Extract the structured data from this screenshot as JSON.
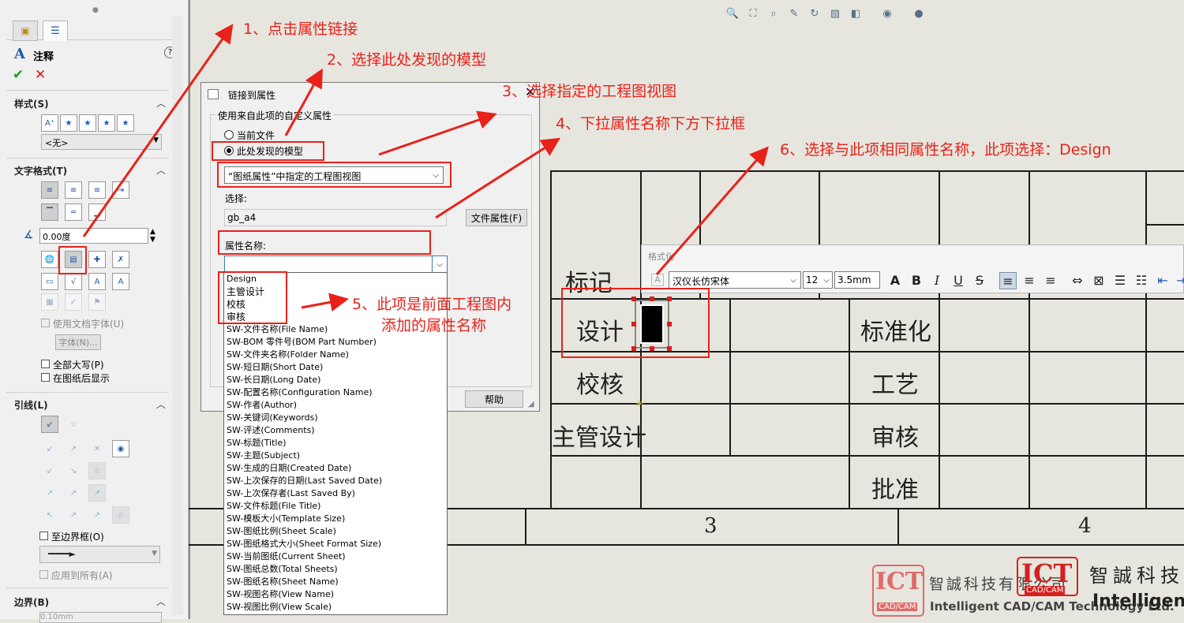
{
  "property_manager": {
    "title": "注释",
    "sections": {
      "style": "样式(S)",
      "text_format": "文字格式(T)",
      "leader": "引线(L)",
      "border": "边界(B)"
    },
    "style_select": "<无>",
    "angle_value": "0.00度",
    "use_doc_font": "使用文档字体(U)",
    "font_button": "字体(N)...",
    "all_caps": "全部大写(P)",
    "show_behind": "在图纸后显示",
    "to_border": "至边界框(O)",
    "apply_all": "应用到所有(A)",
    "border_value": "0.10mm"
  },
  "dialog": {
    "title": "链接到属性",
    "group_label": "使用来自此项的自定义属性",
    "radio_current": "当前文件",
    "radio_model": "此处发现的模型",
    "model_select": "“图纸属性”中指定的工程图视图",
    "select_label": "选择:",
    "select_value": "gb_a4",
    "file_props_button": "文件属性(F)",
    "prop_name_label": "属性名称:",
    "help_button": "帮助"
  },
  "dropdown_items": [
    "Design",
    "主管设计",
    "校核",
    "审核",
    "SW-文件名称(File Name)",
    "SW-BOM 零件号(BOM Part Number)",
    "SW-文件夹名称(Folder Name)",
    "SW-短日期(Short Date)",
    "SW-长日期(Long Date)",
    "SW-配置名称(Configuration Name)",
    "SW-作者(Author)",
    "SW-关键词(Keywords)",
    "SW-评述(Comments)",
    "SW-标题(Title)",
    "SW-主题(Subject)",
    "SW-生成的日期(Created Date)",
    "SW-上次保存的日期(Last Saved Date)",
    "SW-上次保存者(Last Saved By)",
    "SW-文件标题(File Title)",
    "SW-模板大小(Template Size)",
    "SW-图纸比例(Sheet Scale)",
    "SW-图纸格式大小(Sheet Format Size)",
    "SW-当前图纸(Current Sheet)",
    "SW-图纸总数(Total Sheets)",
    "SW-图纸名称(Sheet Name)",
    "SW-视图名称(View Name)",
    "SW-视图比例(View Scale)"
  ],
  "title_block": {
    "cells": [
      "标记",
      "设计",
      "校核",
      "主管设计",
      "标准化",
      "工艺",
      "审核",
      "批准"
    ],
    "zone_3": "3",
    "zone_4": "4"
  },
  "format_toolbar": {
    "title": "格式化",
    "font": "汉仪长仿宋体",
    "size": "12",
    "height": "3.5mm"
  },
  "annotations": [
    "1、点击属性链接",
    "2、选择此处发现的模型",
    "3、选择指定的工程图视图",
    "4、下拉属性名称下方下拉框",
    "5、此项是前面工程图内",
    "添加的属性名称",
    "6、选择与此项相同属性名称，此项选择：Design"
  ],
  "watermark": {
    "logo": "ICT",
    "logo_sub": "CAD/CAM",
    "company_cn": "智誠科技有限公司",
    "company_cn2": "智誠科技",
    "company_en": "Intelligent CAD/CAM Technology Ltd.",
    "company_en2": "Intelligent"
  },
  "colors": {
    "annotation": "#e8221a",
    "background": "#e6e6de",
    "panel": "#f0f0f0"
  }
}
